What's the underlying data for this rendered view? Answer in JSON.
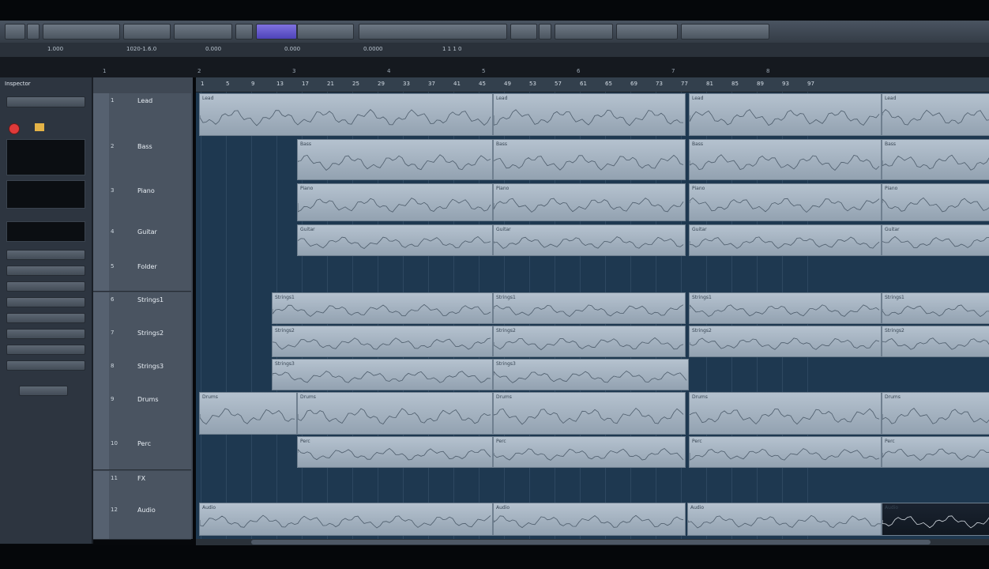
{
  "toolbar": {
    "buttons": [
      "",
      "",
      "",
      "",
      "",
      "",
      "",
      "",
      "",
      "",
      "",
      "",
      "",
      ""
    ]
  },
  "info_line": [
    "1.000",
    "1020-1.6.0",
    "0.000",
    "0.000",
    "0.0000",
    "1 1 1 0"
  ],
  "overview_ticks": [
    "1",
    "2",
    "3",
    "4",
    "5",
    "6",
    "7",
    "8"
  ],
  "inspector": {
    "header": "Inspector",
    "record_icon": "record-icon",
    "monitor_icon": "monitor-icon"
  },
  "tracks": [
    {
      "num": "1",
      "name": "Lead"
    },
    {
      "num": "2",
      "name": "Bass"
    },
    {
      "num": "3",
      "name": "Piano"
    },
    {
      "num": "4",
      "name": "Guitar"
    },
    {
      "num": "5",
      "name": "Folder"
    },
    {
      "num": "6",
      "name": "Strings1"
    },
    {
      "num": "7",
      "name": "Strings2"
    },
    {
      "num": "8",
      "name": "Strings3"
    },
    {
      "num": "9",
      "name": "Drums"
    },
    {
      "num": "10",
      "name": "Perc"
    },
    {
      "num": "11",
      "name": "FX"
    },
    {
      "num": "12",
      "name": "Audio"
    }
  ],
  "ruler_labels": [
    "1",
    "5",
    "9",
    "13",
    "17",
    "21",
    "25",
    "29",
    "33",
    "37",
    "41",
    "45",
    "49",
    "53",
    "57",
    "61",
    "65",
    "69",
    "73",
    "77",
    "81",
    "85",
    "89",
    "93",
    "97"
  ],
  "parts": [
    {
      "track": 0,
      "label": "Lead"
    },
    {
      "track": 1,
      "label": "Bass"
    },
    {
      "track": 2,
      "label": "Piano"
    },
    {
      "track": 3,
      "label": "Guitar"
    },
    {
      "track": 5,
      "label": "Strings1"
    },
    {
      "track": 6,
      "label": "Strings2"
    },
    {
      "track": 7,
      "label": "Strings3"
    },
    {
      "track": 8,
      "label": "Drums"
    },
    {
      "track": 9,
      "label": "Perc"
    },
    {
      "track": 11,
      "label": "Audio"
    }
  ],
  "colors": {
    "accent": "#5a4fd0",
    "record": "#e03a3a",
    "part": "#a7b5c3",
    "arrange_bg": "#1e3850"
  }
}
